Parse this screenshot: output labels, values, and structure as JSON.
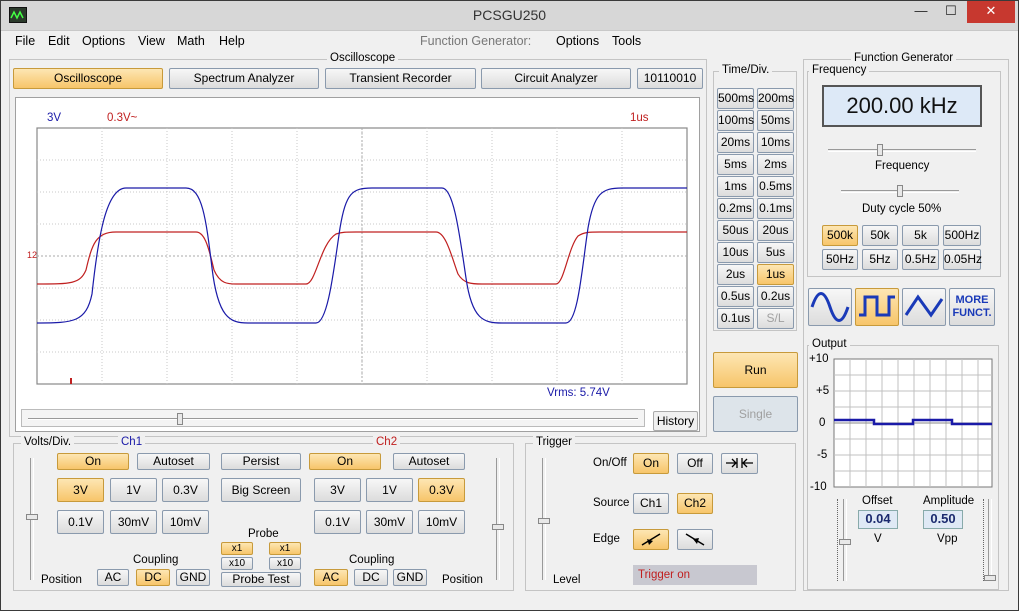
{
  "app": {
    "title": "PCSGU250"
  },
  "window_controls": {
    "minimize": "—",
    "maximize": "☐",
    "close": "✕"
  },
  "menu": {
    "file": "File",
    "edit": "Edit",
    "options": "Options",
    "view": "View",
    "math": "Math",
    "help": "Help",
    "fg_label": "Function Generator:",
    "fg_options": "Options",
    "fg_tools": "Tools"
  },
  "osc": {
    "group_title": "Oscilloscope",
    "tabs": [
      "Oscilloscope",
      "Spectrum Analyzer",
      "Transient Recorder",
      "Circuit Analyzer",
      "10110010"
    ],
    "ch1_scale": "3V",
    "ch2_scale": "0.3V~",
    "timebase": "1us",
    "vrms": "Vrms: 5.74V",
    "marker": "12",
    "history": "History"
  },
  "timediv": {
    "title": "Time/Div.",
    "buttons": [
      "500ms",
      "200ms",
      "100ms",
      "50ms",
      "20ms",
      "10ms",
      "5ms",
      "2ms",
      "1ms",
      "0.5ms",
      "0.2ms",
      "0.1ms",
      "50us",
      "20us",
      "10us",
      "5us",
      "2us",
      "1us",
      "0.5us",
      "0.2us",
      "0.1us",
      "S/L"
    ],
    "selected": "1us"
  },
  "run": {
    "run": "Run",
    "single": "Single"
  },
  "volts": {
    "title": "Volts/Div.",
    "ch1": "Ch1",
    "ch2": "Ch2",
    "on": "On",
    "autoset": "Autoset",
    "persist": "Persist",
    "big_screen": "Big Screen",
    "values": [
      "3V",
      "1V",
      "0.3V",
      "0.1V",
      "30mV",
      "10mV"
    ],
    "ch1_selected": "3V",
    "ch2_selected": "0.3V",
    "probe": "Probe",
    "x1": "x1",
    "x10": "x10",
    "probe_test": "Probe Test",
    "coupling": "Coupling",
    "ac": "AC",
    "dc": "DC",
    "gnd": "GND",
    "position": "Position",
    "ch1_coupling": "DC",
    "ch2_coupling": "AC"
  },
  "trigger": {
    "title": "Trigger",
    "onoff": "On/Off",
    "on": "On",
    "off": "Off",
    "source": "Source",
    "ch1": "Ch1",
    "ch2": "Ch2",
    "edge": "Edge",
    "level": "Level",
    "status": "Trigger on"
  },
  "fg": {
    "title": "Function Generator",
    "freq_title": "Frequency",
    "freq_value": "200.00 kHz",
    "freq_label": "Frequency",
    "duty": "Duty cycle 50%",
    "ranges": [
      "500k",
      "50k",
      "5k",
      "500Hz",
      "50Hz",
      "5Hz",
      "0.5Hz",
      "0.05Hz"
    ],
    "range_selected": "500k",
    "more": "MORE FUNCT.",
    "wave_selected": "square",
    "output_title": "Output",
    "y_ticks": [
      "+10",
      "+5",
      "0",
      "-5",
      "-10"
    ],
    "offset_label": "Offset",
    "offset_value": "0.04",
    "offset_unit": "V",
    "amp_label": "Amplitude",
    "amp_value": "0.50",
    "amp_unit": "Vpp"
  },
  "colors": {
    "ch1": "#1a1aa8",
    "ch2": "#c02020",
    "accent": "#f7c56a"
  }
}
